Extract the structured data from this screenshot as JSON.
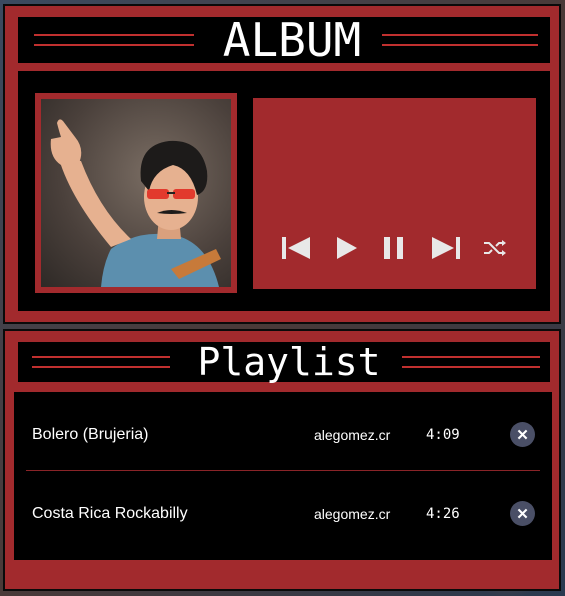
{
  "album": {
    "title": "ALBUM",
    "controls": [
      {
        "name": "previous",
        "icon": "skip-previous-icon"
      },
      {
        "name": "play",
        "icon": "play-icon"
      },
      {
        "name": "pause",
        "icon": "pause-icon"
      },
      {
        "name": "next",
        "icon": "skip-next-icon"
      },
      {
        "name": "shuffle",
        "icon": "shuffle-icon"
      }
    ]
  },
  "playlist": {
    "title": "Playlist",
    "tracks": [
      {
        "title": "Bolero (Brujeria)",
        "artist": "alegomez.cr",
        "duration": "4:09",
        "remove_icon": "close-icon"
      },
      {
        "title": "Costa Rica Rockabilly",
        "artist": "alegomez.cr",
        "duration": "4:26",
        "remove_icon": "close-icon"
      }
    ]
  },
  "colors": {
    "panel": "#a22a2d",
    "background_dark": "#000000",
    "accent_line": "#c0302f",
    "remove_button": "#4a4f66"
  }
}
